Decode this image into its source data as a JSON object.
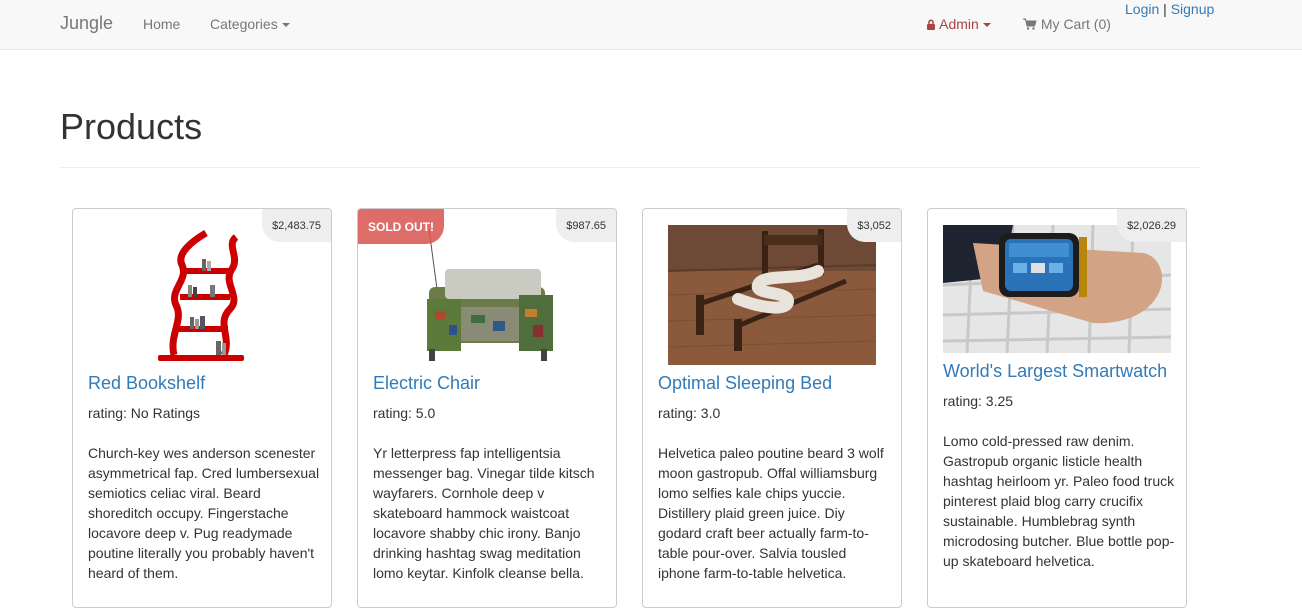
{
  "navbar": {
    "brand": "Jungle",
    "home": "Home",
    "categories": "Categories",
    "admin": "Admin",
    "cart": "My Cart (0)",
    "login": "Login",
    "separator": "|",
    "signup": "Signup"
  },
  "page": {
    "title": "Products"
  },
  "products": [
    {
      "name": "Red Bookshelf",
      "price": "$2,483.75",
      "rating": "rating: No Ratings",
      "sold_out": "",
      "description": "Church-key wes anderson scenester asymmetrical fap. Cred lumbersexual semiotics celiac viral. Beard shoreditch occupy. Fingerstache locavore deep v. Pug readymade poutine literally you probably haven't heard of them."
    },
    {
      "name": "Electric Chair",
      "price": "$987.65",
      "rating": "rating: 5.0",
      "sold_out": "SOLD OUT!",
      "description": "Yr letterpress fap intelligentsia messenger bag. Vinegar tilde kitsch wayfarers. Cornhole deep v skateboard hammock waistcoat locavore shabby chic irony. Banjo drinking hashtag swag meditation lomo keytar. Kinfolk cleanse bella."
    },
    {
      "name": "Optimal Sleeping Bed",
      "price": "$3,052",
      "rating": "rating: 3.0",
      "sold_out": "",
      "description": "Helvetica paleo poutine beard 3 wolf moon gastropub. Offal williamsburg lomo selfies kale chips yuccie. Distillery plaid green juice. Diy godard craft beer actually farm-to-table pour-over. Salvia tousled iphone farm-to-table helvetica."
    },
    {
      "name": "World's Largest Smartwatch",
      "price": "$2,026.29",
      "rating": "rating: 3.25",
      "sold_out": "",
      "description": "Lomo cold-pressed raw denim. Gastropub organic listicle health hashtag heirloom yr. Paleo food truck pinterest plaid blog carry crucifix sustainable. Humblebrag synth microdosing butcher. Blue bottle pop-up skateboard helvetica."
    }
  ],
  "colors": {
    "link": "#337ab7",
    "admin": "#a94442",
    "sold_out": "#d9534f"
  },
  "icons": {
    "admin": "lock-icon",
    "cart": "shopping-cart-icon"
  }
}
